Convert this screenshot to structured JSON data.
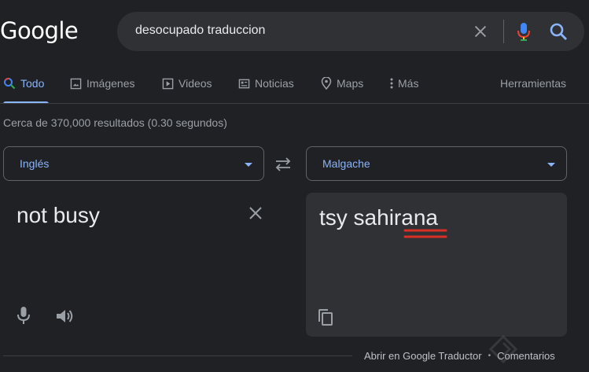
{
  "logo": {
    "text": "Google"
  },
  "search": {
    "query": "desocupado traduccion"
  },
  "tabs": [
    {
      "label": "Todo",
      "icon": "search-icon"
    },
    {
      "label": "Imágenes",
      "icon": "image-icon"
    },
    {
      "label": "Videos",
      "icon": "play-icon"
    },
    {
      "label": "Noticias",
      "icon": "news-icon"
    },
    {
      "label": "Maps",
      "icon": "map-pin-icon"
    },
    {
      "label": "Más",
      "icon": "more-vert-icon"
    }
  ],
  "tools_label": "Herramientas",
  "stats": "Cerca de 370,000 resultados (0.30 segundos)",
  "translator": {
    "source_lang": "Inglés",
    "target_lang": "Malgache",
    "source_text": "not busy",
    "target_text": "tsy sahirana"
  },
  "footer": {
    "open_link": "Abrir en Google Traductor",
    "feedback_link": "Comentarios"
  },
  "colors": {
    "background": "#202124",
    "accent": "#8ab4f8",
    "misspelling": "#d93025"
  }
}
